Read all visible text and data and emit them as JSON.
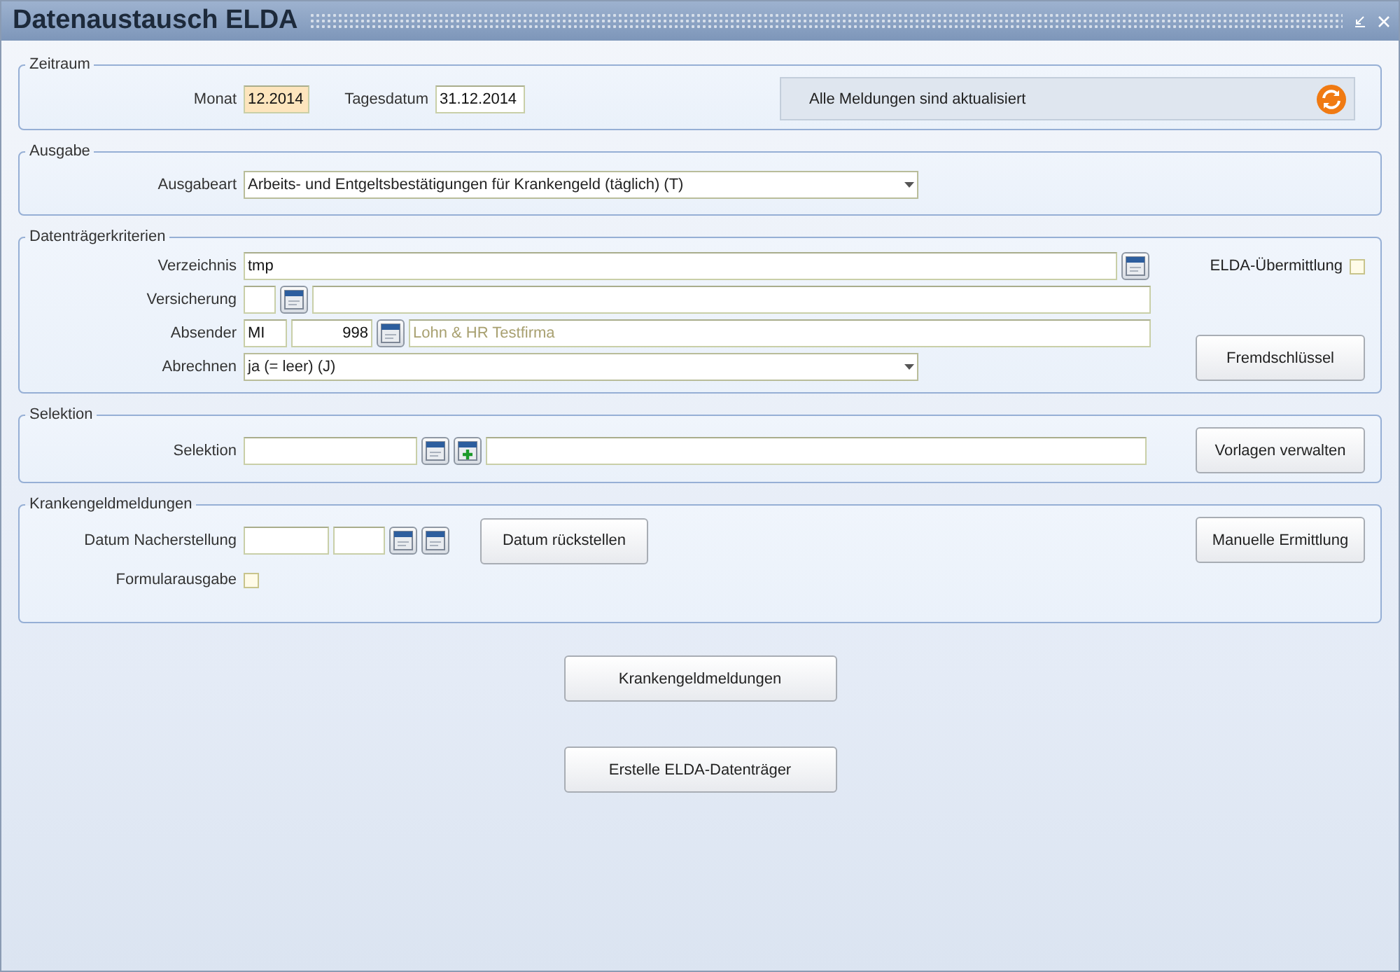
{
  "window": {
    "title": "Datenaustausch ELDA"
  },
  "zeitraum": {
    "legend": "Zeitraum",
    "monat": {
      "label": "Monat",
      "value": "12.2014"
    },
    "tagesdatum": {
      "label": "Tagesdatum",
      "value": "31.12.2014"
    },
    "status": "Alle Meldungen sind aktualisiert"
  },
  "ausgabe": {
    "legend": "Ausgabe",
    "ausgabeart": {
      "label": "Ausgabeart",
      "value": "Arbeits- und Entgeltsbestätigungen für Krankengeld (täglich) (T)"
    }
  },
  "datentraeger": {
    "legend": "Datenträgerkriterien",
    "verzeichnis": {
      "label": "Verzeichnis",
      "value": "tmp"
    },
    "versicherung": {
      "label": "Versicherung"
    },
    "absender": {
      "label": "Absender",
      "code": "MI",
      "number": "998",
      "name": "Lohn & HR Testfirma"
    },
    "abrechnen": {
      "label": "Abrechnen",
      "value": "ja (= leer) (J)"
    },
    "elda_uebermittlung": {
      "label": "ELDA-Übermittlung",
      "checked": false
    },
    "button": "Fremdschlüssel"
  },
  "selektion": {
    "legend": "Selektion",
    "label": "Selektion",
    "button": "Vorlagen verwalten"
  },
  "krankengeld": {
    "legend": "Krankengeldmeldungen",
    "datum_label": "Datum Nacherstellung",
    "reset_button": "Datum rückstellen",
    "formular": {
      "label": "Formularausgabe",
      "checked": false
    },
    "manual_button": "Manuelle Ermittlung"
  },
  "actions": [
    "Krankengeldmeldungen",
    "Erstelle ELDA-Datenträger"
  ]
}
